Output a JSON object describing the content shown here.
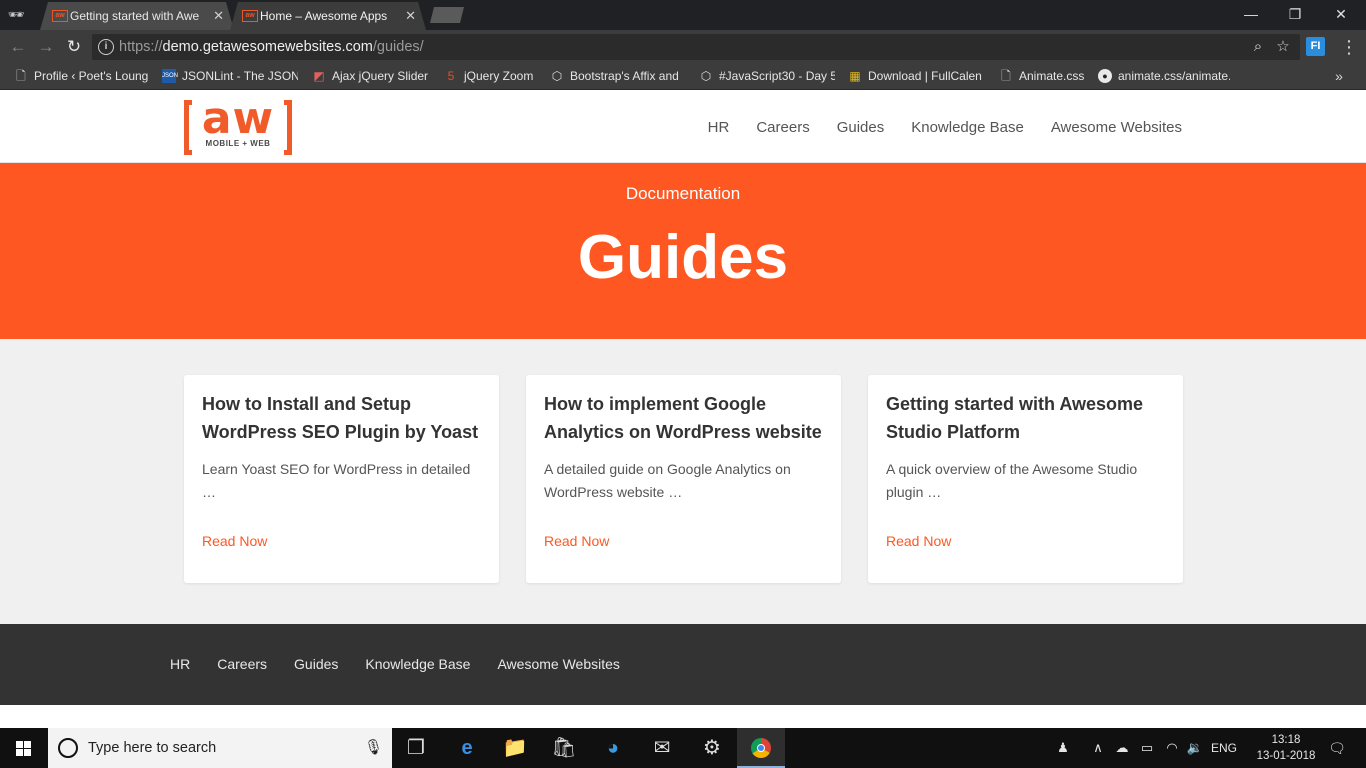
{
  "browser": {
    "tabs": [
      {
        "title": "Getting started with Awe",
        "active": false
      },
      {
        "title": "Home – Awesome Apps",
        "active": true
      }
    ],
    "tab_close_glyph": "✕",
    "window_controls": {
      "minimize": "—",
      "restore": "❐",
      "close": "✕"
    },
    "address": {
      "scheme": "https://",
      "host": "demo.getawesomewebsites.com",
      "path": "/guides/"
    },
    "extension_label": "FI",
    "bookmarks": [
      {
        "label": "Profile ‹ Poet's Loung",
        "icon": "page-icon"
      },
      {
        "label": "JSONLint - The JSON",
        "icon": "jsonlint-icon"
      },
      {
        "label": "Ajax jQuery Slider",
        "icon": "slider-icon"
      },
      {
        "label": "jQuery Zoom",
        "icon": "html5-icon"
      },
      {
        "label": "Bootstrap's Affix and",
        "icon": "codepen-icon"
      },
      {
        "label": "#JavaScript30 - Day 5",
        "icon": "codepen-icon"
      },
      {
        "label": "Download | FullCalen",
        "icon": "calendar-icon"
      },
      {
        "label": "Animate.css",
        "icon": "page-icon"
      },
      {
        "label": "animate.css/animate.",
        "icon": "github-icon"
      }
    ],
    "bookmarks_more": "»"
  },
  "site": {
    "logo": {
      "mark": "aw",
      "tagline": "MOBILE + WEB"
    },
    "nav": [
      "HR",
      "Careers",
      "Guides",
      "Knowledge Base",
      "Awesome Websites"
    ],
    "hero": {
      "eyebrow": "Documentation",
      "title": "Guides"
    },
    "cards": [
      {
        "title": "How to Install and Setup WordPress SEO Plugin by Yoast",
        "excerpt": "Learn Yoast SEO for WordPress in detailed …",
        "link": "Read Now"
      },
      {
        "title": "How to implement Google Analytics on WordPress website",
        "excerpt": "A detailed guide on Google Analytics on WordPress website …",
        "link": "Read Now"
      },
      {
        "title": "Getting started with Awesome Studio Platform",
        "excerpt": "A quick overview of the Awesome Studio plugin …",
        "link": "Read Now"
      }
    ],
    "footer_nav": [
      "HR",
      "Careers",
      "Guides",
      "Knowledge Base",
      "Awesome Websites"
    ]
  },
  "taskbar": {
    "search_placeholder": "Type here to search",
    "language": "ENG",
    "time": "13:18",
    "date": "13-01-2018"
  },
  "colors": {
    "accent": "#ff5722",
    "footer": "#333333",
    "content_bg": "#f0f0f0"
  }
}
